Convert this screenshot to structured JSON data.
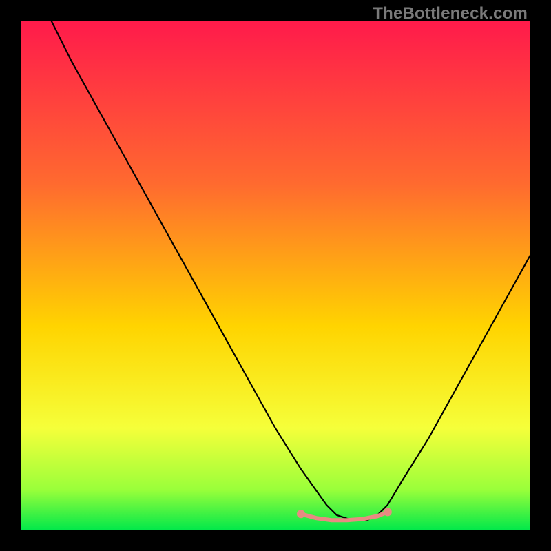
{
  "watermark": {
    "text": "TheBottleneck.com"
  },
  "colors": {
    "gradient": [
      "#ff1a4b",
      "#ff6a2f",
      "#ffd400",
      "#f5ff3a",
      "#9aff3a",
      "#00e84a"
    ],
    "curve": "#000000",
    "marker_fill": "#e88b82",
    "marker_stroke": "#e88b82",
    "background": "#000000"
  },
  "chart_data": {
    "type": "line",
    "title": "",
    "xlabel": "",
    "ylabel": "",
    "xlim": [
      0,
      100
    ],
    "ylim": [
      0,
      100
    ],
    "grid": false,
    "legend": false,
    "series": [
      {
        "name": "bottleneck-curve",
        "x": [
          6,
          10,
          15,
          20,
          25,
          30,
          35,
          40,
          45,
          50,
          55,
          60,
          62,
          65,
          68,
          70,
          72,
          75,
          80,
          85,
          90,
          95,
          100
        ],
        "y": [
          100,
          92,
          83,
          74,
          65,
          56,
          47,
          38,
          29,
          20,
          12,
          5,
          3,
          2,
          2,
          3,
          5,
          10,
          18,
          27,
          36,
          45,
          54
        ]
      }
    ],
    "flat_region_markers": {
      "x": [
        55,
        58,
        61,
        64,
        67,
        70,
        72
      ],
      "y": [
        3.2,
        2.4,
        2.0,
        2.0,
        2.2,
        2.8,
        3.6
      ]
    }
  }
}
